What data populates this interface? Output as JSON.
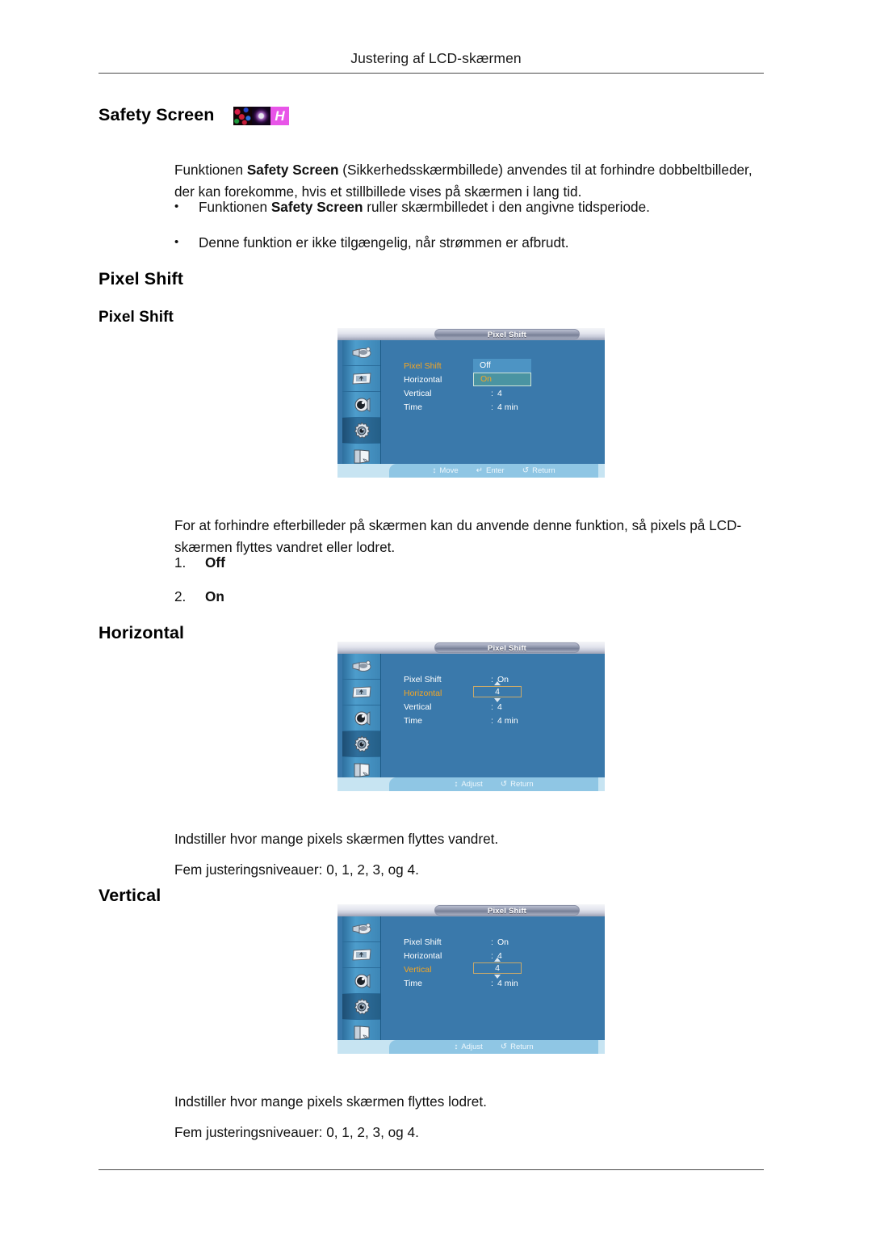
{
  "page": {
    "running_head": "Justering af LCD-skærmen"
  },
  "sections": {
    "safety": {
      "title": "Safety Screen",
      "icon_letter": "H",
      "paragraph_pre": "Funktionen ",
      "paragraph_bold": "Safety Screen",
      "paragraph_post": " (Sikkerhedsskærmbillede) anvendes til at forhindre dobbeltbilleder, der kan forekomme, hvis et stillbillede vises på skærmen i lang tid.",
      "bullets": [
        {
          "pre": "Funktionen ",
          "bold": "Safety Screen",
          "post": " ruller skærmbilledet i den angivne tidsperiode."
        },
        {
          "pre": "Denne funktion er ikke tilgængelig, når strømmen er afbrudt.",
          "bold": "",
          "post": ""
        }
      ]
    },
    "pixel_shift": {
      "title": "Pixel Shift",
      "subtitle": "Pixel Shift",
      "description": "For at forhindre efterbilleder på skærmen kan du anvende denne funktion, så pixels på LCD-skærmen flyttes vandret eller lodret.",
      "options": [
        {
          "number": "1.",
          "label": "Off"
        },
        {
          "number": "2.",
          "label": "On"
        }
      ]
    },
    "horizontal": {
      "title": "Horizontal",
      "description": "Indstiller hvor mange pixels skærmen flyttes vandret.",
      "levels": "Fem justeringsniveauer: 0, 1, 2, 3, og 4."
    },
    "vertical": {
      "title": "Vertical",
      "description": "Indstiller hvor mange pixels skærmen flyttes lodret.",
      "levels": "Fem justeringsniveauer: 0, 1, 2, 3, og 4."
    }
  },
  "osd": {
    "menu_title": "Pixel Shift",
    "labels": {
      "pixel_shift": "Pixel Shift",
      "horizontal": "Horizontal",
      "vertical": "Vertical",
      "time": "Time",
      "colon": ":"
    },
    "colors": {
      "background": "#3a79ab",
      "highlight_text": "#f5a623",
      "rail": "#4d9dcc",
      "footer": "#8fc6e4",
      "spinner_border": "#c8a96a"
    },
    "rail_icons": [
      "picture-input-icon",
      "screen-icon",
      "sound-icon",
      "setup-gear-icon",
      "multi-control-icon"
    ],
    "screen1": {
      "selected_row": "Pixel Shift",
      "dropdown_open": true,
      "dropdown_options": [
        "Off",
        "On"
      ],
      "dropdown_selected": "On",
      "rows": [
        {
          "label": "Pixel Shift",
          "value": "Off"
        },
        {
          "label": "Horizontal",
          "value": ""
        },
        {
          "label": "Vertical",
          "value": "4"
        },
        {
          "label": "Time",
          "value": "4 min"
        }
      ],
      "footer": [
        {
          "glyph": "↕",
          "label": "Move"
        },
        {
          "glyph": "↵",
          "label": "Enter"
        },
        {
          "glyph": "↺",
          "label": "Return"
        }
      ]
    },
    "screen2": {
      "selected_row": "Horizontal",
      "spinner_value": "4",
      "rows": [
        {
          "label": "Pixel Shift",
          "value": "On"
        },
        {
          "label": "Horizontal",
          "value": "4"
        },
        {
          "label": "Vertical",
          "value": "4"
        },
        {
          "label": "Time",
          "value": "4 min"
        }
      ],
      "footer": [
        {
          "glyph": "↕",
          "label": "Adjust"
        },
        {
          "glyph": "↺",
          "label": "Return"
        }
      ]
    },
    "screen3": {
      "selected_row": "Vertical",
      "spinner_value": "4",
      "rows": [
        {
          "label": "Pixel Shift",
          "value": "On"
        },
        {
          "label": "Horizontal",
          "value": "4"
        },
        {
          "label": "Vertical",
          "value": "4"
        },
        {
          "label": "Time",
          "value": "4 min"
        }
      ],
      "footer": [
        {
          "glyph": "↕",
          "label": "Adjust"
        },
        {
          "glyph": "↺",
          "label": "Return"
        }
      ]
    }
  }
}
